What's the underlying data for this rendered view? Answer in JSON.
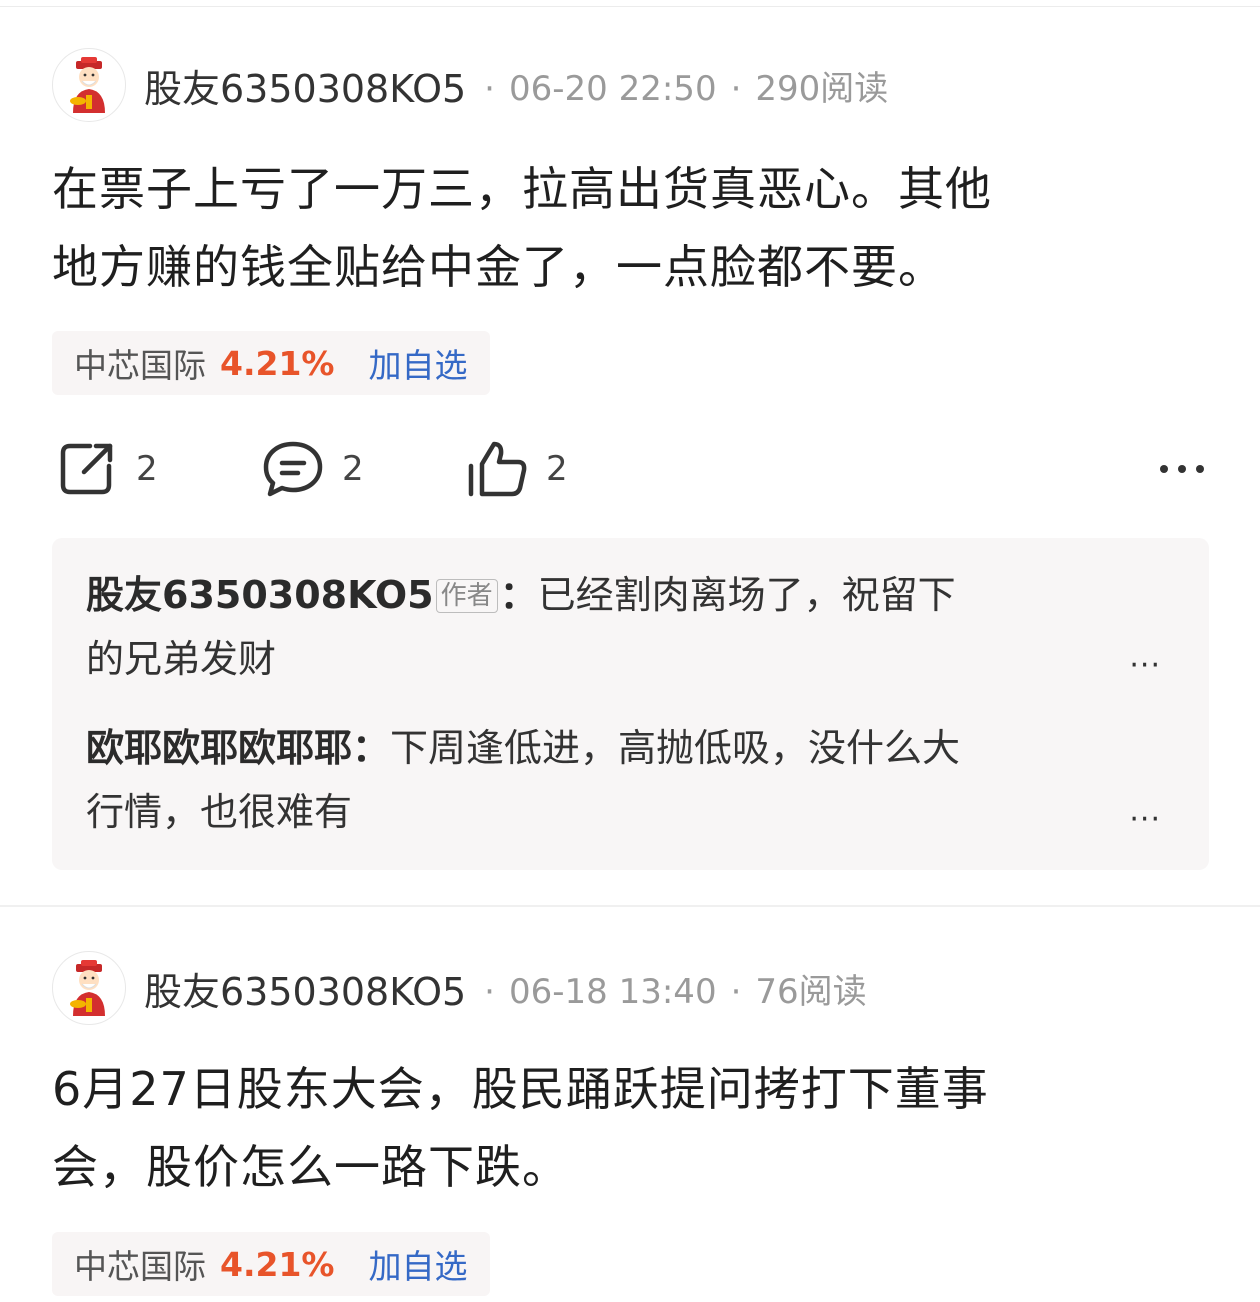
{
  "posts": [
    {
      "username": "股友6350308KO5",
      "date": "06-20 22:50",
      "reads": "290阅读",
      "content_lines": [
        "在票子上亏了一万三，拉高出货真恶心。其他",
        "地方赚的钱全贴给中金了，一点脸都不要。"
      ],
      "stock": {
        "name": "中芯国际",
        "change": "4.21%",
        "add_label": "加自选"
      },
      "actions": {
        "share_count": "2",
        "comment_count": "2",
        "like_count": "2"
      },
      "comments": [
        {
          "user": "股友6350308KO5",
          "badge": "作者",
          "sep": "：",
          "text": "已经割肉离场了，祝留下的兄弟发财",
          "line1": "已经割肉离场了，祝留下",
          "line2": "的兄弟发财"
        },
        {
          "user": "欧耶欧耶欧耶耶",
          "badge": "",
          "sep": "：",
          "text": "下周逢低进，高抛低吸，没什么大行情，也很难有",
          "line1": "下周逢低进，高抛低吸，没什么大",
          "line2": "行情，也很难有"
        }
      ]
    },
    {
      "username": "股友6350308KO5",
      "date": "06-18 13:40",
      "reads": "76阅读",
      "content_lines": [
        "6月27日股东大会，股民踊跃提问拷打下董事",
        "会，股价怎么一路下跌。"
      ],
      "stock": {
        "name": "中芯国际",
        "change": "4.21%",
        "add_label": "加自选"
      }
    }
  ],
  "colors": {
    "rise": "#e8542a",
    "link": "#3569c6",
    "meta": "#9a9a9a"
  },
  "icons": [
    "share-icon",
    "comment-icon",
    "like-icon",
    "more-icon",
    "avatar-caishen-icon"
  ]
}
